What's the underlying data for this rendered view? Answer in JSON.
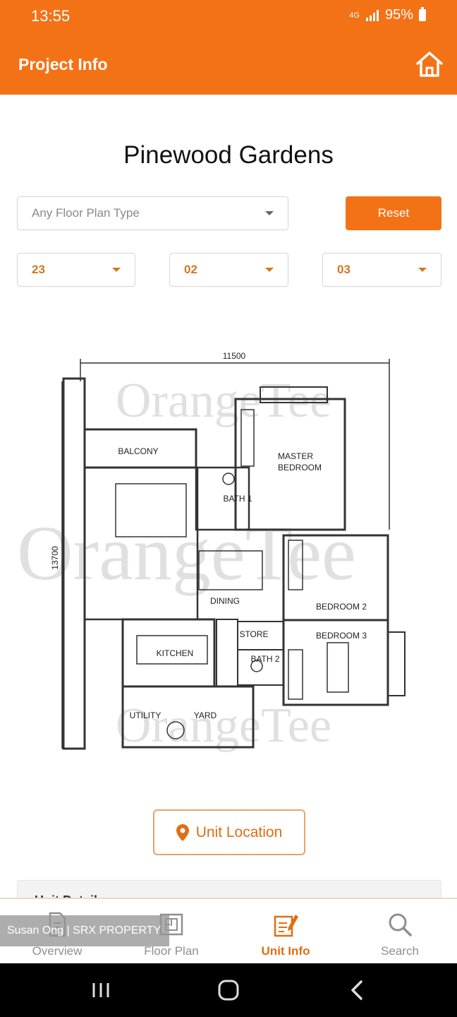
{
  "status_bar": {
    "time": "13:55",
    "network": "4G",
    "battery": "95%"
  },
  "app_bar": {
    "title": "Project Info"
  },
  "project": {
    "name": "Pinewood Gardens"
  },
  "filters": {
    "floor_plan_type": "Any Floor Plan Type",
    "reset_label": "Reset",
    "selects": [
      "23",
      "02",
      "03"
    ]
  },
  "floor_plan": {
    "watermark": "OrangeTee",
    "dimension_width": "11500",
    "dimension_height": "13700",
    "rooms": {
      "balcony": "BALCONY",
      "master_bedroom_1": "MASTER",
      "master_bedroom_2": "BEDROOM",
      "bath1": "BATH 1",
      "dining": "DINING",
      "bedroom2": "BEDROOM 2",
      "bedroom3": "BEDROOM 3",
      "store": "STORE",
      "kitchen": "KITCHEN",
      "bath2": "BATH 2",
      "utility": "UTILITY",
      "yard": "YARD"
    }
  },
  "unit_location": {
    "label": "Unit Location"
  },
  "unit_detail": {
    "title": "Unit Details"
  },
  "bottom_nav": {
    "items": [
      {
        "label": "Overview",
        "icon": "document-icon"
      },
      {
        "label": "Floor Plan",
        "icon": "floor-plan-icon"
      },
      {
        "label": "Unit Info",
        "icon": "unit-info-icon"
      },
      {
        "label": "Search",
        "icon": "search-icon"
      }
    ],
    "active": "Unit Info"
  },
  "watermark_label": "Susan Ong | SRX PROPERTY",
  "colors": {
    "brand": "#f47216",
    "accent_text": "#e06e14",
    "inactive": "#8f8f8f"
  }
}
